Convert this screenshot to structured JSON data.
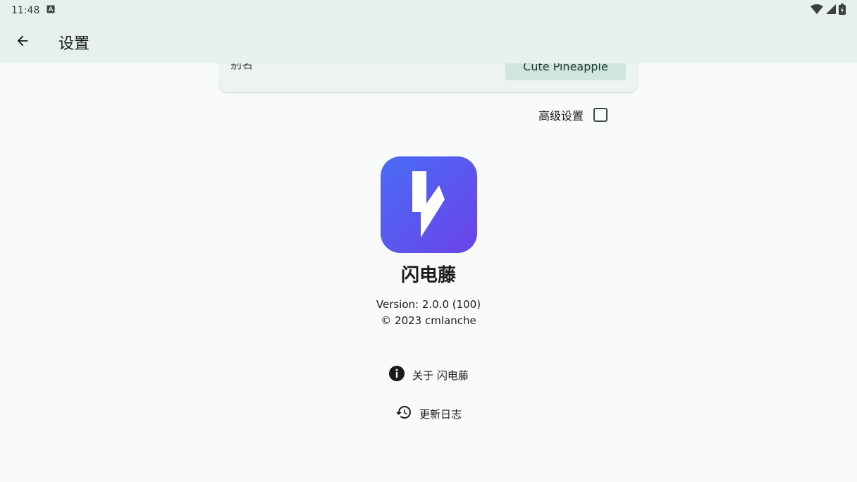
{
  "statusbar": {
    "time": "11:48"
  },
  "appbar": {
    "title": "设置"
  },
  "card": {
    "label": "别名",
    "button_label": "Cute Pineapple"
  },
  "advanced": {
    "label": "高级设置",
    "checked": false
  },
  "about": {
    "app_name": "闪电藤",
    "version": "Version: 2.0.0 (100)",
    "copyright": "© 2023 cmlanche"
  },
  "links": {
    "about_label": "关于 闪电藤",
    "changelog_label": "更新日志"
  },
  "colors": {
    "appbar_bg": "#e6f0ec",
    "logo_gradient_start": "#4a6cf7",
    "logo_gradient_end": "#6b43e6"
  }
}
